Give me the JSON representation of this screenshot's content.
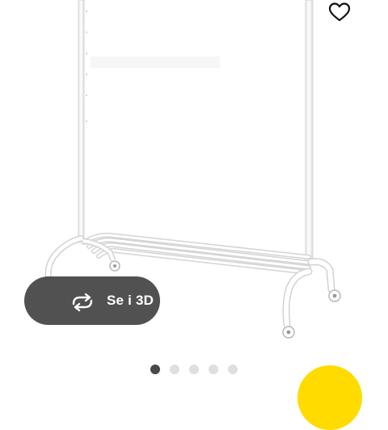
{
  "product": {
    "image_name": "clothes-rack-white"
  },
  "favourite": {
    "icon": "heart-outline-icon"
  },
  "view_3d": {
    "label": "Se i 3D",
    "icon": "rotate-3d-icon",
    "background": "#484848"
  },
  "carousel": {
    "count": 5,
    "active_index": 0,
    "active_color": "#484848",
    "inactive_color": "#dfdfdf"
  },
  "cart_button": {
    "color": "#ffdb00"
  }
}
